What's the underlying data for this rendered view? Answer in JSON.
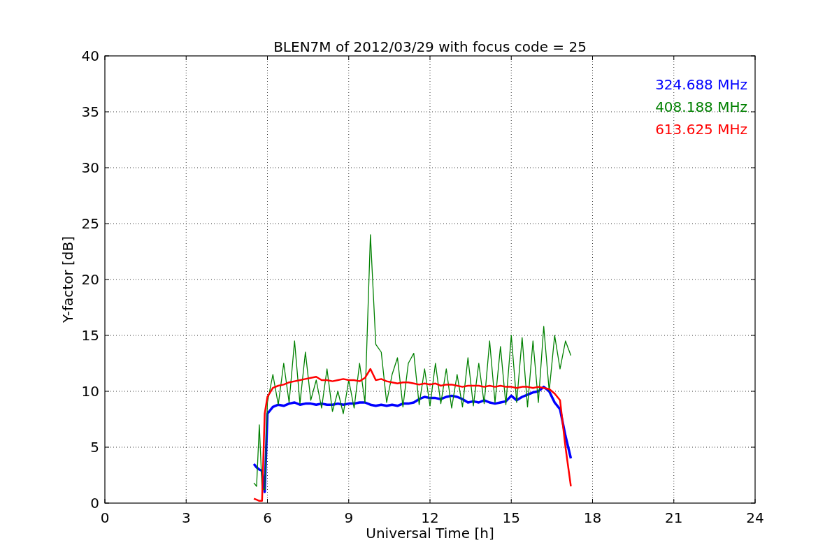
{
  "chart": {
    "chart_data": {
      "type": "line",
      "title": "BLEN7M of 2012/03/29 with focus code = 25",
      "xlabel": "Universal Time [h]",
      "ylabel": "Y-factor [dB]",
      "x": [
        5.5,
        5.6,
        5.7,
        5.8,
        5.9,
        6.0,
        6.2,
        6.4,
        6.6,
        6.8,
        7.0,
        7.2,
        7.4,
        7.6,
        7.8,
        8.0,
        8.2,
        8.4,
        8.6,
        8.8,
        9.0,
        9.2,
        9.4,
        9.6,
        9.8,
        10.0,
        10.2,
        10.4,
        10.6,
        10.8,
        11.0,
        11.2,
        11.4,
        11.6,
        11.8,
        12.0,
        12.2,
        12.4,
        12.6,
        12.8,
        13.0,
        13.2,
        13.4,
        13.6,
        13.8,
        14.0,
        14.2,
        14.4,
        14.6,
        14.8,
        15.0,
        15.2,
        15.4,
        15.6,
        15.8,
        16.0,
        16.2,
        16.4,
        16.6,
        16.8,
        17.0,
        17.2
      ],
      "series": [
        {
          "name": "324.688 MHz",
          "color": "#0000ff",
          "values": [
            3.5,
            3.2,
            3.0,
            2.9,
            1.0,
            8.0,
            8.6,
            8.8,
            8.7,
            8.9,
            9.0,
            8.8,
            8.9,
            8.9,
            8.8,
            8.9,
            8.8,
            8.8,
            8.9,
            8.8,
            8.9,
            8.9,
            9.0,
            9.0,
            8.8,
            8.7,
            8.8,
            8.7,
            8.8,
            8.7,
            8.9,
            8.9,
            9.0,
            9.3,
            9.5,
            9.4,
            9.4,
            9.3,
            9.5,
            9.6,
            9.5,
            9.3,
            9.0,
            9.1,
            9.0,
            9.2,
            9.0,
            8.9,
            9.0,
            9.1,
            9.6,
            9.2,
            9.5,
            9.7,
            9.9,
            10.0,
            10.4,
            10.0,
            9.0,
            8.4,
            6.0,
            4.0
          ]
        },
        {
          "name": "408.188 MHz",
          "color": "#008000",
          "values": [
            1.8,
            1.5,
            7.0,
            1.3,
            1.2,
            9.0,
            11.5,
            8.8,
            12.5,
            9.0,
            14.5,
            8.9,
            13.5,
            9.2,
            11.0,
            8.5,
            12.0,
            8.2,
            10.0,
            8.0,
            11.0,
            8.5,
            12.5,
            9.0,
            24.0,
            14.2,
            13.5,
            9.0,
            11.5,
            13.0,
            8.6,
            12.5,
            13.4,
            8.8,
            12.0,
            8.7,
            12.5,
            8.9,
            12.0,
            8.5,
            11.5,
            8.6,
            13.0,
            8.7,
            12.5,
            8.9,
            14.5,
            9.0,
            14.0,
            8.8,
            15.0,
            9.0,
            14.8,
            8.6,
            14.5,
            9.0,
            15.8,
            10.0,
            15.0,
            12.0,
            14.5,
            13.2
          ]
        },
        {
          "name": "613.625 MHz",
          "color": "#ff0000",
          "values": [
            0.4,
            0.3,
            0.2,
            0.2,
            8.0,
            9.5,
            10.3,
            10.5,
            10.6,
            10.8,
            10.9,
            11.0,
            11.1,
            11.2,
            11.3,
            11.0,
            11.0,
            10.9,
            11.0,
            11.1,
            11.0,
            11.0,
            10.9,
            11.2,
            12.0,
            11.0,
            11.1,
            10.9,
            10.8,
            10.7,
            10.8,
            10.8,
            10.7,
            10.6,
            10.7,
            10.6,
            10.7,
            10.5,
            10.6,
            10.6,
            10.5,
            10.4,
            10.5,
            10.5,
            10.5,
            10.4,
            10.5,
            10.4,
            10.5,
            10.4,
            10.4,
            10.3,
            10.4,
            10.4,
            10.3,
            10.4,
            10.3,
            10.2,
            9.8,
            9.2,
            5.0,
            1.5
          ]
        }
      ],
      "grid": true,
      "xlim": [
        0,
        24
      ],
      "ylim": [
        0,
        40
      ],
      "xticks": [
        0,
        3,
        6,
        9,
        12,
        15,
        18,
        21,
        24
      ],
      "yticks": [
        0,
        5,
        10,
        15,
        20,
        25,
        30,
        35,
        40
      ]
    }
  }
}
